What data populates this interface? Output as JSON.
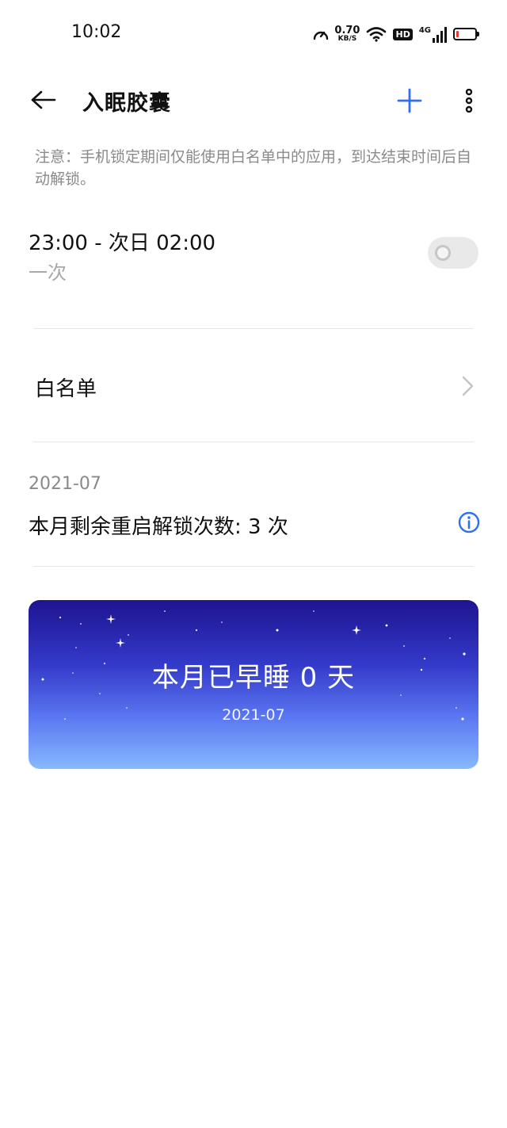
{
  "status_bar": {
    "time": "10:02",
    "net_speed_value": "0.70",
    "net_speed_unit": "KB/S",
    "hd_label": "HD",
    "network_type": "4G"
  },
  "header": {
    "title": "入眠胶囊"
  },
  "notice": "注意：手机锁定期间仅能使用白名单中的应用，到达结束时间后自动解锁。",
  "schedule": {
    "time_range": "23:00 - 次日 02:00",
    "repeat": "一次",
    "enabled": false
  },
  "whitelist": {
    "label": "白名单"
  },
  "unlock": {
    "month": "2021-07",
    "remaining_text": "本月剩余重启解锁次数: 3 次"
  },
  "banner": {
    "title": "本月已早睡 0 天",
    "month": "2021-07"
  },
  "colors": {
    "accent": "#2f6ff0",
    "banner_top": "#1e1490",
    "banner_bottom": "#87b9ff"
  }
}
